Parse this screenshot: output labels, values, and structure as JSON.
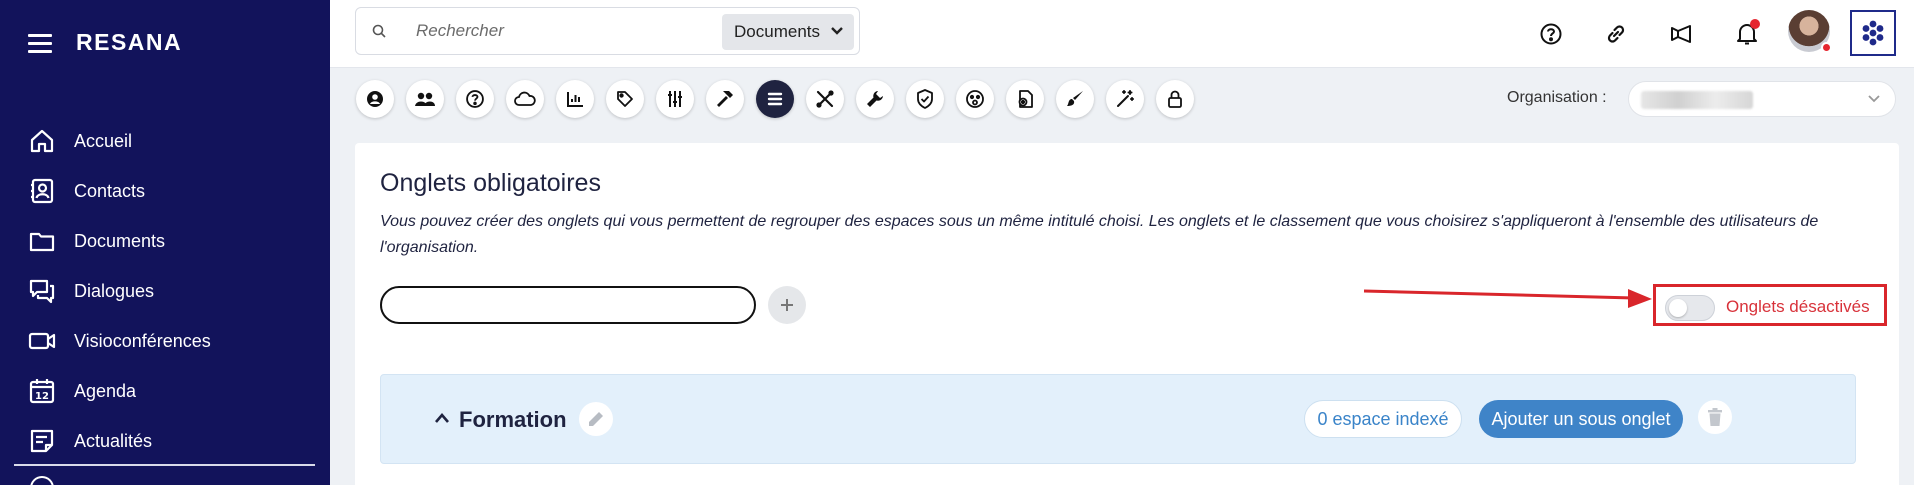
{
  "app": {
    "brand": "RESANA"
  },
  "sidebar": {
    "items": [
      {
        "label": "Accueil",
        "icon": "home-icon"
      },
      {
        "label": "Contacts",
        "icon": "contacts-icon"
      },
      {
        "label": "Documents",
        "icon": "folder-icon"
      },
      {
        "label": "Dialogues",
        "icon": "chat-icon"
      },
      {
        "label": "Visioconférences",
        "icon": "video-icon"
      },
      {
        "label": "Agenda",
        "icon": "calendar-icon"
      },
      {
        "label": "Actualités",
        "icon": "news-icon"
      }
    ],
    "calendar_day": "12"
  },
  "search": {
    "placeholder": "Rechercher",
    "scope": "Documents"
  },
  "toolbar": {
    "icons": [
      "user-circle-icon",
      "group-icon",
      "help-circle-icon",
      "cloud-icon",
      "chart-icon",
      "tag-icon",
      "sliders-icon",
      "hammer-icon",
      "list-icon",
      "tools-icon",
      "wrench-icon",
      "shield-check-icon",
      "emoji-icon",
      "document-settings-icon",
      "brush-icon",
      "magic-wand-icon",
      "lock-icon"
    ],
    "active": "list-icon"
  },
  "organisation": {
    "label": "Organisation :"
  },
  "panel": {
    "title": "Onglets obligatoires",
    "description": "Vous pouvez créer des onglets qui vous permettent de regrouper des espaces sous un même intitulé choisi. Les onglets et le classement que vous choisirez s'appliqueront à l'ensemble des utilisateurs de l'organisation.",
    "input_value": "",
    "toggle_label": "Onglets désactivés",
    "toggle_on": false
  },
  "section": {
    "title": "Formation",
    "indexed": "0 espace indexé",
    "add_sub": "Ajouter un sous onglet"
  },
  "colors": {
    "sidebar": "#12135b",
    "accent": "#3f84c8",
    "alert": "#d9262b"
  }
}
